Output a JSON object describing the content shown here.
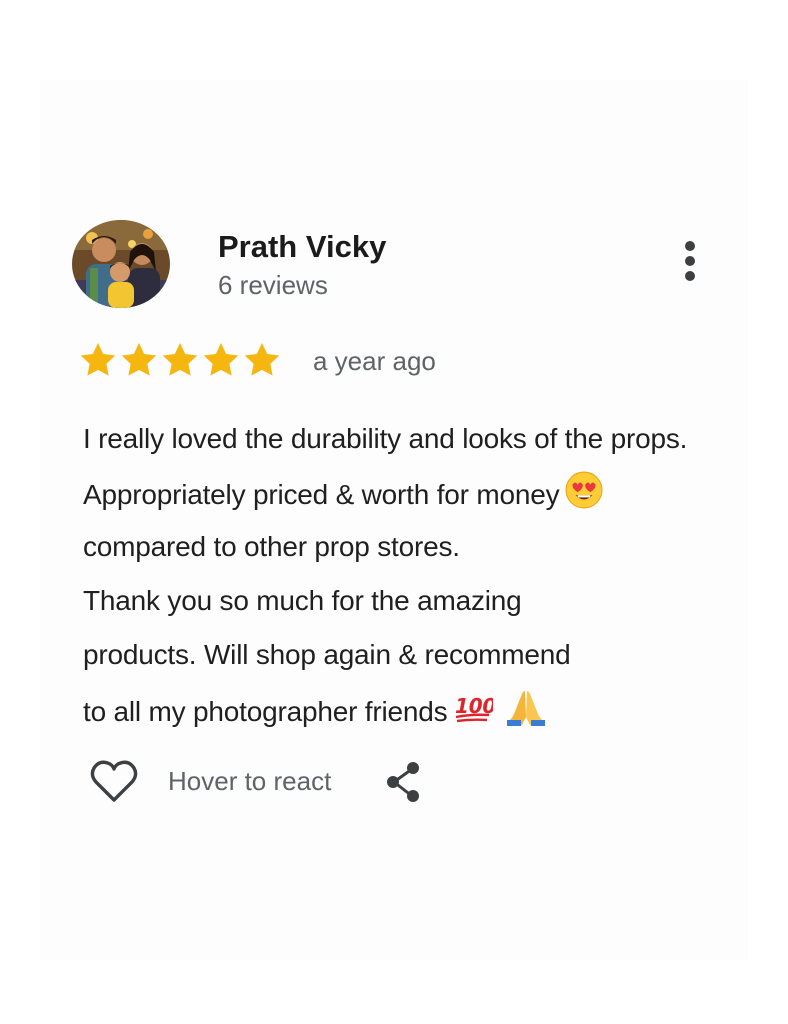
{
  "reviewer": {
    "name": "Prath Vicky",
    "review_count": "6 reviews"
  },
  "icons": {
    "avatar": "family-photo-avatar",
    "more": "more-vert-icon",
    "star": "star-icon",
    "heart": "heart-outline-icon",
    "share": "share-icon",
    "emoji_heart_eyes": "heart-eyes-emoji",
    "emoji_hundred": "hundred-points-emoji",
    "emoji_pray": "folded-hands-emoji"
  },
  "rating": {
    "stars": 5,
    "max": 5,
    "color": "#F5B60F"
  },
  "review": {
    "time": "a year ago",
    "lines": [
      "I really loved the durability and looks of the props.",
      "Appropriately priced & worth for money",
      "compared to other prop stores.",
      "Thank you so much for the amazing",
      "products. Will shop again & recommend",
      "to all my photographer friends"
    ]
  },
  "actions": {
    "react_label": "Hover to react"
  },
  "colors": {
    "text_primary": "#1F1F1F",
    "text_secondary": "#5F6368",
    "icon": "#3C4043",
    "star": "#F5B60F"
  }
}
